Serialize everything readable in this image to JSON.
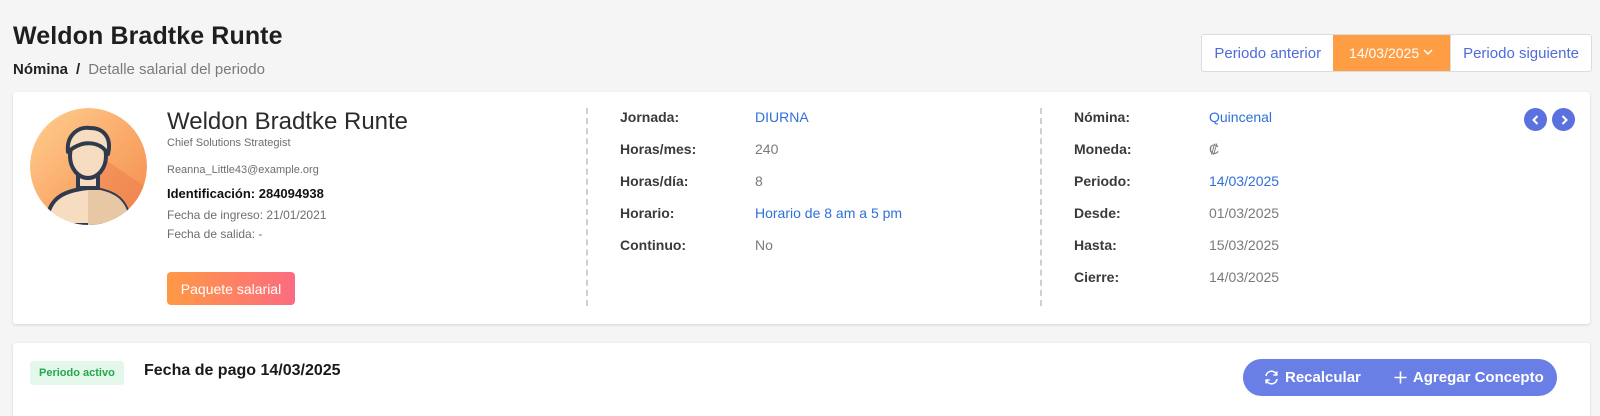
{
  "header": {
    "title": "Weldon Bradtke Runte",
    "breadcrumb": {
      "root": "Nómina",
      "separator": "/",
      "current": "Detalle salarial del periodo"
    }
  },
  "period_nav": {
    "prev_label": "Periodo anterior",
    "current_period": "14/03/2025",
    "next_label": "Periodo siguiente"
  },
  "employee": {
    "name": "Weldon Bradtke Runte",
    "role": "Chief Solutions Strategist",
    "email": "Reanna_Little43@example.org",
    "identification": "Identificación: 284094938",
    "hire_date": "Fecha de ingreso: 21/01/2021",
    "exit_date": "Fecha de salida: -",
    "package_button": "Paquete salarial"
  },
  "schedule": [
    {
      "label": "Jornada:",
      "value": "DIURNA"
    },
    {
      "label": "Horas/mes:",
      "value": "240"
    },
    {
      "label": "Horas/día:",
      "value": "8"
    },
    {
      "label": "Horario:",
      "value": "Horario de 8 am a 5 pm"
    },
    {
      "label": "Continuo:",
      "value": "No"
    }
  ],
  "payroll": [
    {
      "label": "Nómina:",
      "value": "Quincenal"
    },
    {
      "label": "Moneda:",
      "value": "₡"
    },
    {
      "label": "Periodo:",
      "value": "14/03/2025"
    },
    {
      "label": "Desde:",
      "value": "01/03/2025"
    },
    {
      "label": "Hasta:",
      "value": "15/03/2025"
    },
    {
      "label": "Cierre:",
      "value": "14/03/2025"
    }
  ],
  "payment": {
    "status_badge": "Periodo activo",
    "pay_date": "Fecha de pago 14/03/2025",
    "recalc_label": "Recalcular",
    "add_concept_label": "Agregar Concepto"
  },
  "colors": {
    "accent": "#ff9d45",
    "link": "#2f6fd8",
    "primary": "#6a7fe6",
    "success": "#23a84f"
  },
  "icons": [
    "chevron-down-icon",
    "user-avatar-icon",
    "chevron-left-icon",
    "chevron-right-icon",
    "refresh-icon",
    "plus-icon"
  ]
}
